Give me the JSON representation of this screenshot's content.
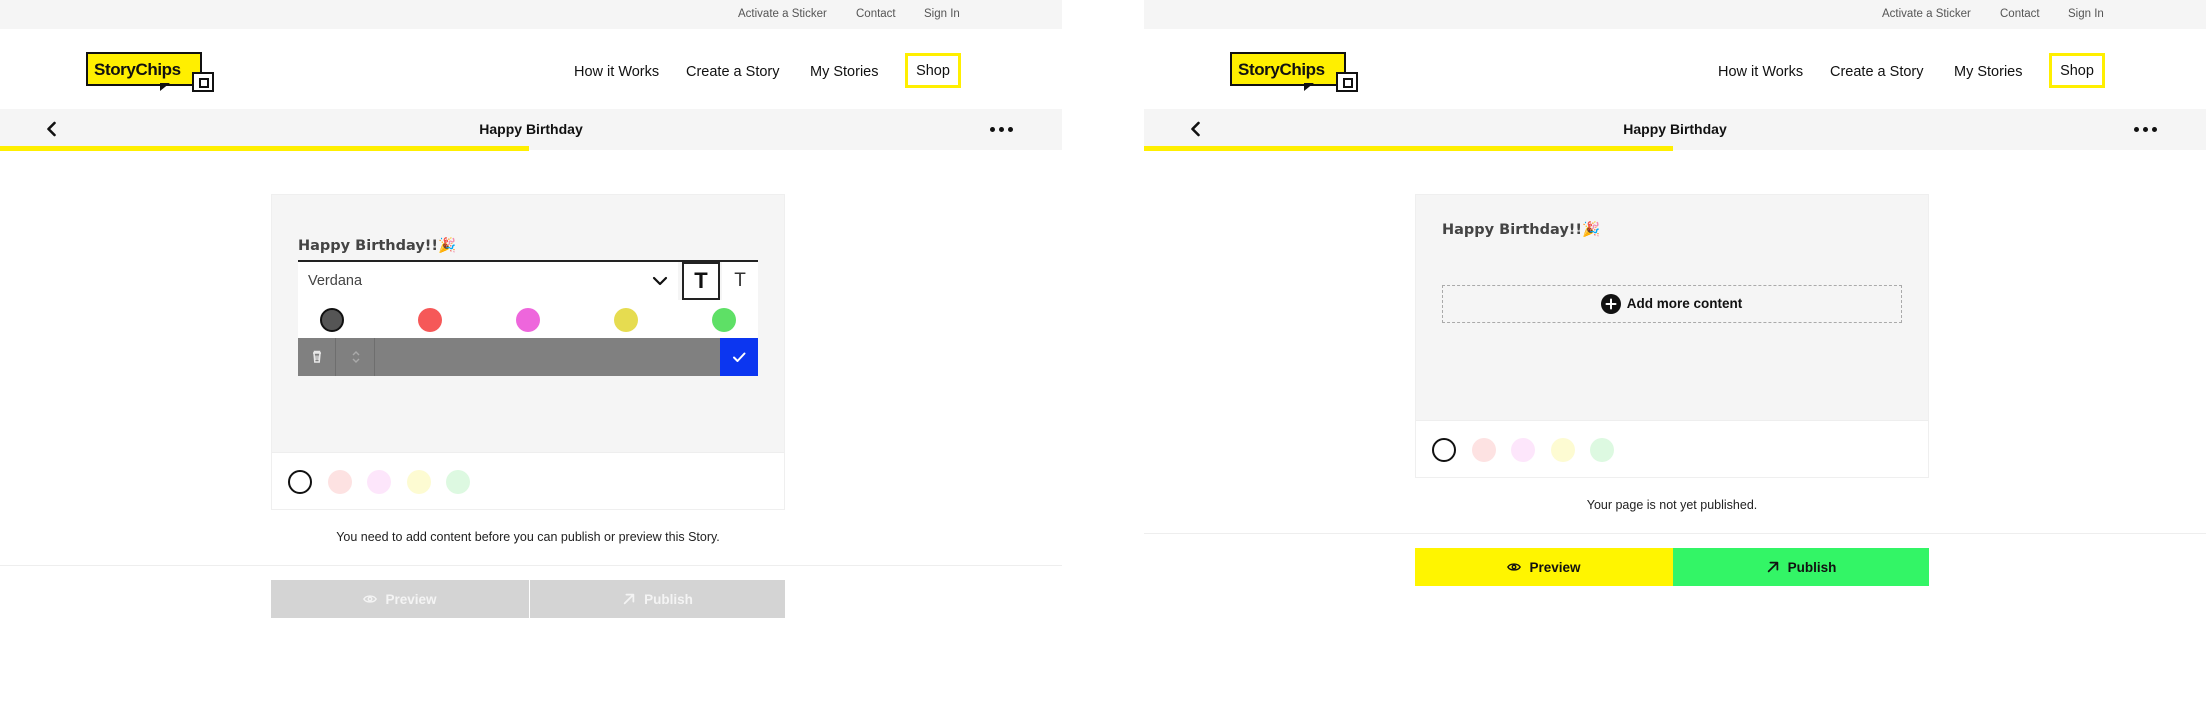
{
  "accent_yellow": "#ffef00",
  "panels": [
    {
      "top_links": [
        "Activate a Sticker",
        "Contact",
        "Sign In"
      ],
      "logo_text": "StoryChips",
      "nav": {
        "how_it_works": "How it Works",
        "create": "Create a Story",
        "my_stories": "My Stories",
        "shop": "Shop"
      },
      "story_title": "Happy Birthday",
      "progress_fraction": 0.5,
      "card": {
        "heading_text": "Happy Birthday!!🎉",
        "font_select_value": "Verdana",
        "bold_label": "T",
        "normal_label": "T",
        "text_colors": [
          "#555555",
          "#f65858",
          "#ee66dc",
          "#e6dc50",
          "#5ee066"
        ],
        "background_colors": [
          "#ffffff",
          "#fde2e2",
          "#fde6fb",
          "#fdfbd2",
          "#ddf9e1"
        ]
      },
      "status_message": "You need to add content before you can publish or preview this Story.",
      "preview_label": "Preview",
      "publish_label": "Publish",
      "buttons_enabled": false
    },
    {
      "top_links": [
        "Activate a Sticker",
        "Contact",
        "Sign In"
      ],
      "logo_text": "StoryChips",
      "nav": {
        "how_it_works": "How it Works",
        "create": "Create a Story",
        "my_stories": "My Stories",
        "shop": "Shop"
      },
      "story_title": "Happy Birthday",
      "progress_fraction": 0.5,
      "card": {
        "heading_text": "Happy Birthday!!🎉",
        "add_more_label": "Add more content",
        "background_colors": [
          "#ffffff",
          "#fde2e2",
          "#fde6fb",
          "#fdfbd2",
          "#ddf9e1"
        ]
      },
      "status_message": "Your page is not yet published.",
      "preview_label": "Preview",
      "publish_label": "Publish",
      "buttons_enabled": true
    }
  ],
  "icons": {
    "back": "chevron-left-icon",
    "more": "more-horizontal-icon",
    "chevron": "chevron-down-icon",
    "delete": "trash-icon",
    "move": "drag-handle-icon",
    "confirm": "check-icon",
    "add": "plus-circle-icon",
    "preview": "eye-icon",
    "publish": "arrow-up-right-icon"
  }
}
